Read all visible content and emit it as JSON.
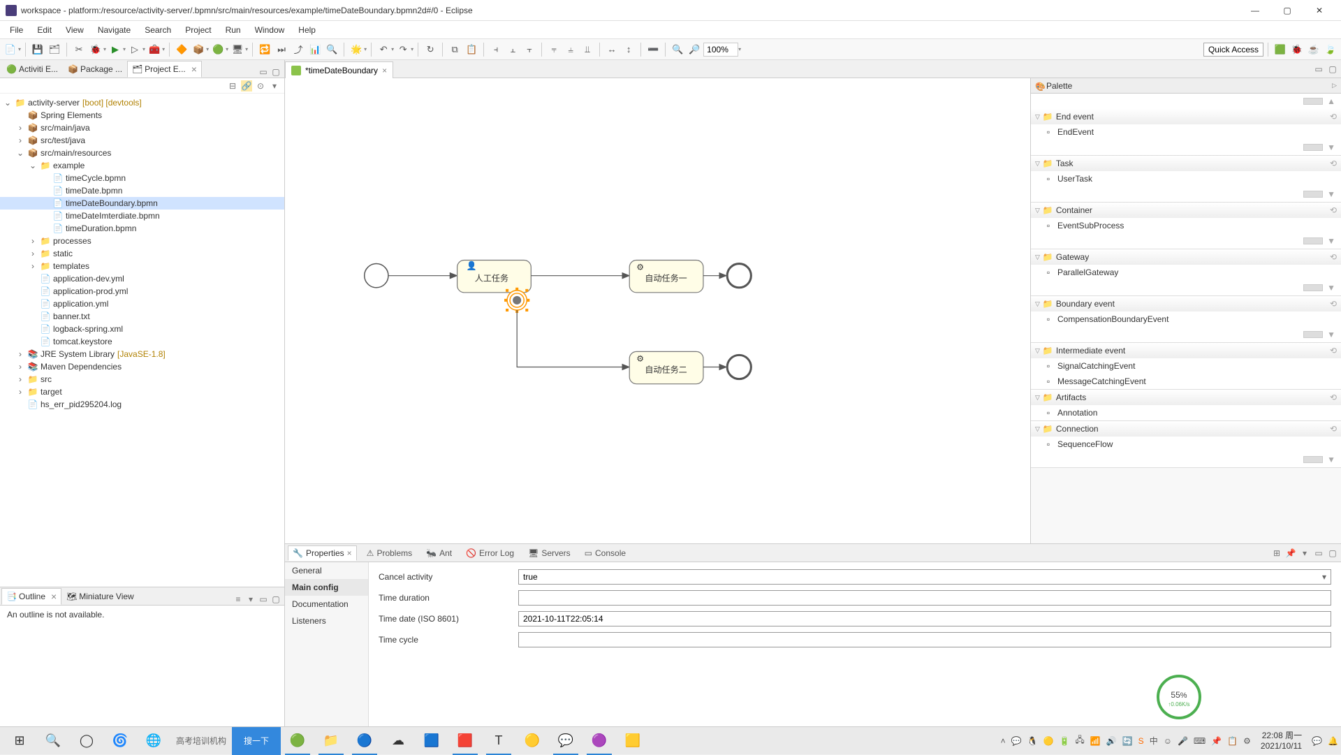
{
  "window": {
    "title": "workspace - platform:/resource/activity-server/.bpmn/src/main/resources/example/timeDateBoundary.bpmn2d#/0 - Eclipse"
  },
  "menu": [
    "File",
    "Edit",
    "View",
    "Navigate",
    "Search",
    "Project",
    "Run",
    "Window",
    "Help"
  ],
  "toolbar": {
    "zoom": "100%",
    "quickAccess": "Quick Access"
  },
  "views": {
    "left": [
      {
        "label": "Activiti E...",
        "active": false
      },
      {
        "label": "Package ...",
        "active": false
      },
      {
        "label": "Project E...",
        "active": true
      }
    ],
    "outline": {
      "title": "Outline",
      "miniature": "Miniature View",
      "empty": "An outline is not available."
    }
  },
  "tree": {
    "root": {
      "label": "activity-server",
      "decor": "[boot] [devtools]"
    },
    "children": [
      {
        "label": "Spring Elements",
        "icon": "pkg",
        "indent": 1
      },
      {
        "label": "src/main/java",
        "icon": "pkg",
        "indent": 1,
        "tw": "›"
      },
      {
        "label": "src/test/java",
        "icon": "pkg",
        "indent": 1,
        "tw": "›"
      },
      {
        "label": "src/main/resources",
        "icon": "pkg",
        "indent": 1,
        "tw": "⌄"
      },
      {
        "label": "example",
        "icon": "folder",
        "indent": 2,
        "tw": "⌄"
      },
      {
        "label": "timeCycle.bpmn",
        "icon": "file",
        "indent": 3
      },
      {
        "label": "timeDate.bpmn",
        "icon": "file",
        "indent": 3
      },
      {
        "label": "timeDateBoundary.bpmn",
        "icon": "file",
        "indent": 3,
        "selected": true
      },
      {
        "label": "timeDateImterdiate.bpmn",
        "icon": "file",
        "indent": 3
      },
      {
        "label": "timeDuration.bpmn",
        "icon": "file",
        "indent": 3
      },
      {
        "label": "processes",
        "icon": "folder",
        "indent": 2,
        "tw": "›"
      },
      {
        "label": "static",
        "icon": "folder",
        "indent": 2,
        "tw": "›"
      },
      {
        "label": "templates",
        "icon": "folder",
        "indent": 2,
        "tw": "›"
      },
      {
        "label": "application-dev.yml",
        "icon": "file",
        "indent": 2
      },
      {
        "label": "application-prod.yml",
        "icon": "file",
        "indent": 2
      },
      {
        "label": "application.yml",
        "icon": "file",
        "indent": 2
      },
      {
        "label": "banner.txt",
        "icon": "file",
        "indent": 2
      },
      {
        "label": "logback-spring.xml",
        "icon": "file",
        "indent": 2
      },
      {
        "label": "tomcat.keystore",
        "icon": "file",
        "indent": 2
      },
      {
        "label": "JRE System Library",
        "decor": "[JavaSE-1.8]",
        "icon": "lib",
        "indent": 1,
        "tw": "›"
      },
      {
        "label": "Maven Dependencies",
        "icon": "lib",
        "indent": 1,
        "tw": "›"
      },
      {
        "label": "src",
        "icon": "folder",
        "indent": 1,
        "tw": "›"
      },
      {
        "label": "target",
        "icon": "folder",
        "indent": 1,
        "tw": "›"
      },
      {
        "label": "hs_err_pid295204.log",
        "icon": "file",
        "indent": 1
      }
    ]
  },
  "editor": {
    "tab": "*timeDateBoundary"
  },
  "diagram": {
    "tasks": {
      "user": "人工任务",
      "auto1": "自动任务一",
      "auto2": "自动任务二"
    }
  },
  "palette": {
    "title": "Palette",
    "cats": [
      {
        "name": "End event",
        "items": [
          "EndEvent"
        ],
        "scroll": true
      },
      {
        "name": "Task",
        "items": [
          "UserTask"
        ],
        "scroll": true
      },
      {
        "name": "Container",
        "items": [
          "EventSubProcess"
        ],
        "scroll": true
      },
      {
        "name": "Gateway",
        "items": [
          "ParallelGateway"
        ],
        "scroll": true
      },
      {
        "name": "Boundary event",
        "items": [
          "CompensationBoundaryEvent"
        ],
        "scroll": true
      },
      {
        "name": "Intermediate event",
        "items": [
          "SignalCatchingEvent",
          "MessageCatchingEvent"
        ],
        "scroll": false
      },
      {
        "name": "Artifacts",
        "items": [
          "Annotation"
        ],
        "scroll": false
      },
      {
        "name": "Connection",
        "items": [
          "SequenceFlow"
        ],
        "scroll": true
      }
    ]
  },
  "bottomTabs": [
    "Properties",
    "Problems",
    "Ant",
    "Error Log",
    "Servers",
    "Console"
  ],
  "propsSide": [
    "General",
    "Main config",
    "Documentation",
    "Listeners"
  ],
  "propsForm": {
    "cancelActivity": {
      "label": "Cancel activity",
      "value": "true"
    },
    "timeDuration": {
      "label": "Time duration",
      "value": ""
    },
    "timeDate": {
      "label": "Time date (ISO 8601)",
      "value": "2021-10-11T22:05:14"
    },
    "timeCycle": {
      "label": "Time cycle",
      "value": ""
    }
  },
  "taskbar": {
    "search_label": "高考培训机构",
    "search_btn": "搜一下",
    "clock_time": "22:08 周一",
    "clock_date": "2021/10/11"
  },
  "perf": {
    "pct": "55",
    "unit": "%",
    "speed": "↑0.06K/s"
  }
}
